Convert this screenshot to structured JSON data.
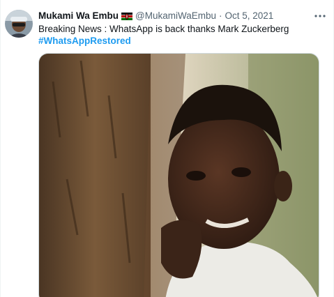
{
  "tweet": {
    "author": {
      "display_name": "Mukami Wa Embu",
      "flag": "kenya-flag",
      "handle": "@MukamiWaEmbu",
      "avatar": "avatar-photo"
    },
    "separator": "·",
    "timestamp": "Oct 5, 2021",
    "text": "Breaking News : WhatsApp is back thanks Mark Zuckerberg",
    "hashtag": "#WhatsAppRestored",
    "more_icon": "more-icon",
    "media": "meme-photo"
  },
  "colors": {
    "text": "#0f1419",
    "secondary": "#536471",
    "link": "#1d9bf0",
    "border": "#eff3f4"
  }
}
